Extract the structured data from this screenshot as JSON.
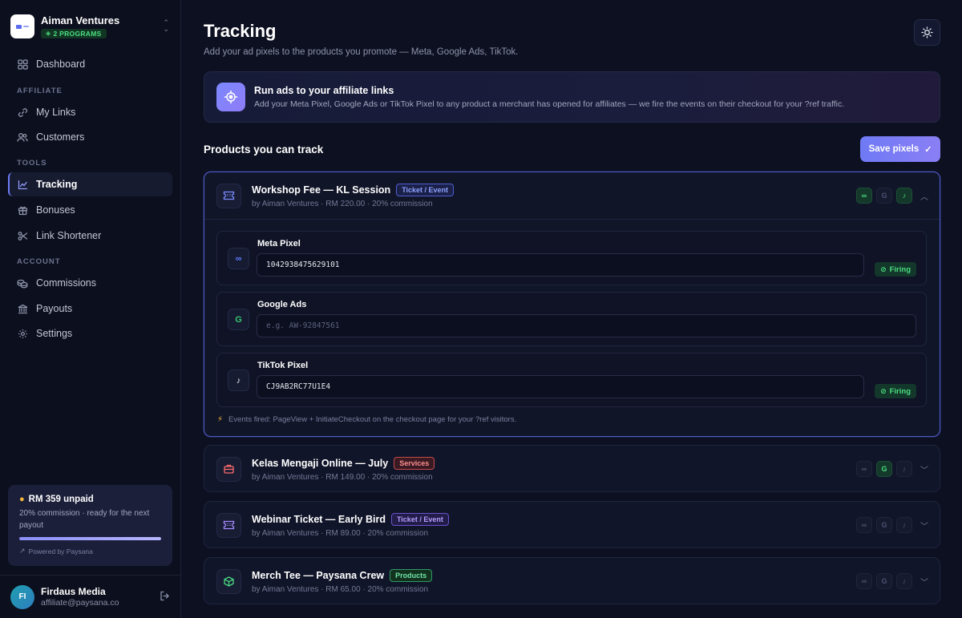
{
  "org": {
    "name": "Aiman Ventures",
    "badge": "2 PROGRAMS"
  },
  "nav": {
    "dashboard": "Dashboard",
    "section_affiliate": "AFFILIATE",
    "my_links": "My Links",
    "customers": "Customers",
    "section_tools": "TOOLS",
    "tracking": "Tracking",
    "bonuses": "Bonuses",
    "link_shortener": "Link Shortener",
    "section_account": "ACCOUNT",
    "commissions": "Commissions",
    "payouts": "Payouts",
    "settings": "Settings"
  },
  "payout": {
    "title": "RM 359 unpaid",
    "desc": "20% commission · ready for the next payout",
    "progress": 1.0,
    "powered": "Powered by Paysana"
  },
  "user": {
    "initials": "FI",
    "name": "Firdaus Media",
    "email": "affiliate@paysana.co"
  },
  "page": {
    "title": "Tracking",
    "subtitle": "Add your ad pixels to the products you promote — Meta, Google Ads, TikTok."
  },
  "banner": {
    "title": "Run ads to your affiliate links",
    "desc": "Add your Meta Pixel, Google Ads or TikTok Pixel to any product a merchant has opened for affiliates — we fire the events on their checkout for your ?ref traffic."
  },
  "section": {
    "title": "Products you can track",
    "save_label": "Save pixels"
  },
  "products": [
    {
      "name": "Workshop Fee — KL Session",
      "tag": "Ticket / Event",
      "meta": "by Aiman Ventures · RM 220.00 · 20% commission",
      "pixels": {
        "meta": true,
        "google": false,
        "tiktok": true
      },
      "expanded": true
    },
    {
      "name": "Kelas Mengaji Online — July",
      "tag": "Services",
      "meta": "by Aiman Ventures · RM 149.00 · 20% commission",
      "pixels": {
        "meta": false,
        "google": true,
        "tiktok": false
      }
    },
    {
      "name": "Webinar Ticket — Early Bird",
      "tag": "Ticket / Event",
      "meta": "by Aiman Ventures · RM 89.00 · 20% commission",
      "pixels": {
        "meta": false,
        "google": false,
        "tiktok": false
      }
    },
    {
      "name": "Merch Tee — Paysana Crew",
      "tag": "Products",
      "meta": "by Aiman Ventures · RM 65.00 · 20% commission",
      "pixels": {
        "meta": false,
        "google": false,
        "tiktok": false
      }
    }
  ],
  "pixel_fields": {
    "meta": {
      "label": "Meta Pixel",
      "value": "1042938475629101",
      "status": "Firing"
    },
    "google": {
      "label": "Google Ads",
      "value": "",
      "placeholder": "e.g. AW-92847561"
    },
    "tiktok": {
      "label": "TikTok Pixel",
      "value": "CJ9AB2RC77U1E4",
      "status": "Firing"
    }
  },
  "events_note": "Events fired: PageView + InitiateCheckout on the checkout page for your ?ref visitors.",
  "colors": {
    "accent": "#6f7af5",
    "firing": "#4ade80",
    "bg": "#0d1020"
  }
}
